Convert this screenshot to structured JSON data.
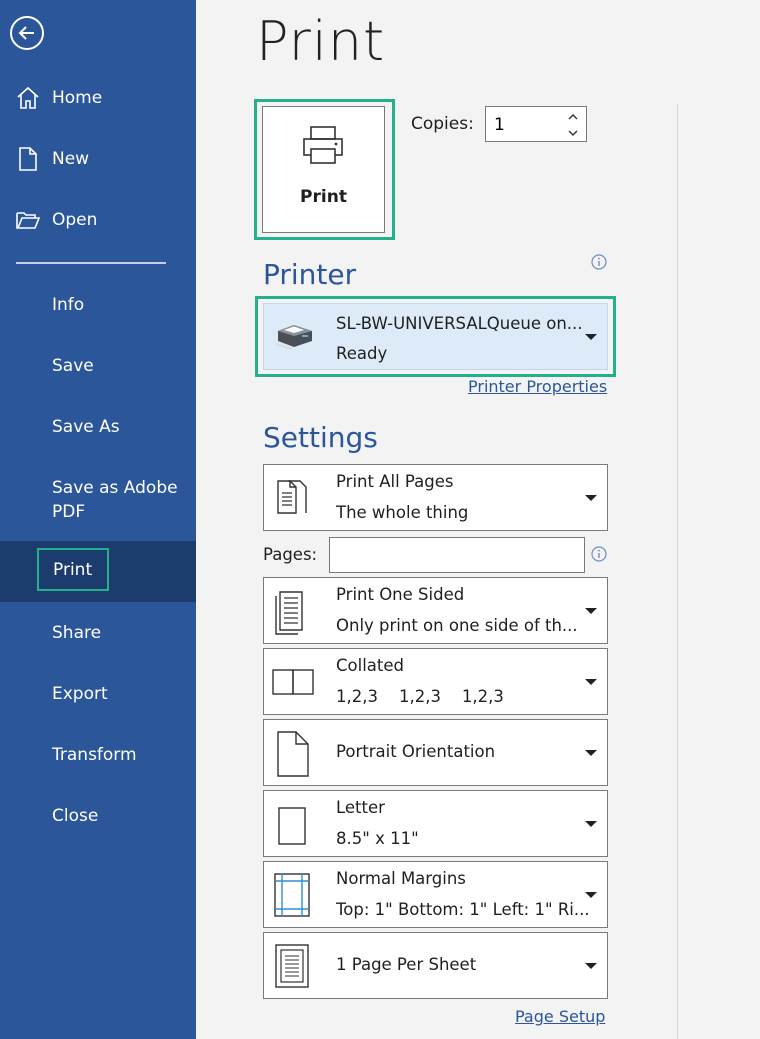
{
  "sidebar": {
    "items": [
      {
        "label": "Home"
      },
      {
        "label": "New"
      },
      {
        "label": "Open"
      },
      {
        "label": "Info"
      },
      {
        "label": "Save"
      },
      {
        "label": "Save As"
      },
      {
        "label": "Save as Adobe PDF"
      },
      {
        "label": "Print"
      },
      {
        "label": "Share"
      },
      {
        "label": "Export"
      },
      {
        "label": "Transform"
      },
      {
        "label": "Close"
      }
    ],
    "active": "Print"
  },
  "header": {
    "title": "Print"
  },
  "print_button": {
    "label": "Print"
  },
  "copies": {
    "label": "Copies:",
    "value": "1"
  },
  "printer": {
    "section_title": "Printer",
    "name": "SL-BW-UNIVERSALQueue on...",
    "status": "Ready",
    "properties_link": "Printer Properties"
  },
  "settings": {
    "section_title": "Settings",
    "pages_label": "Pages:",
    "pages_value": "",
    "dropdowns": [
      {
        "title": "Print All Pages",
        "subtitle": "The whole thing"
      },
      {
        "title": "Print One Sided",
        "subtitle": "Only print on one side of th..."
      },
      {
        "title": "Collated",
        "subtitle": "1,2,3    1,2,3    1,2,3"
      },
      {
        "title": "Portrait Orientation",
        "subtitle": ""
      },
      {
        "title": "Letter",
        "subtitle": "8.5\" x 11\""
      },
      {
        "title": "Normal Margins",
        "subtitle": "Top: 1\" Bottom: 1\" Left: 1\" Ri..."
      },
      {
        "title": "1 Page Per Sheet",
        "subtitle": ""
      }
    ],
    "page_setup_link": "Page Setup"
  },
  "colors": {
    "sidebar_bg": "#2b579a",
    "sidebar_active_bg": "#1b3c6c",
    "highlight_border": "#25b08d",
    "accent_text": "#2b579a",
    "printer_bg": "#ddebf8"
  },
  "icons": {
    "back": "back-arrow-icon",
    "home": "home-icon",
    "new": "new-document-icon",
    "open": "folder-open-icon",
    "print": "printer-icon",
    "info": "info-icon"
  }
}
